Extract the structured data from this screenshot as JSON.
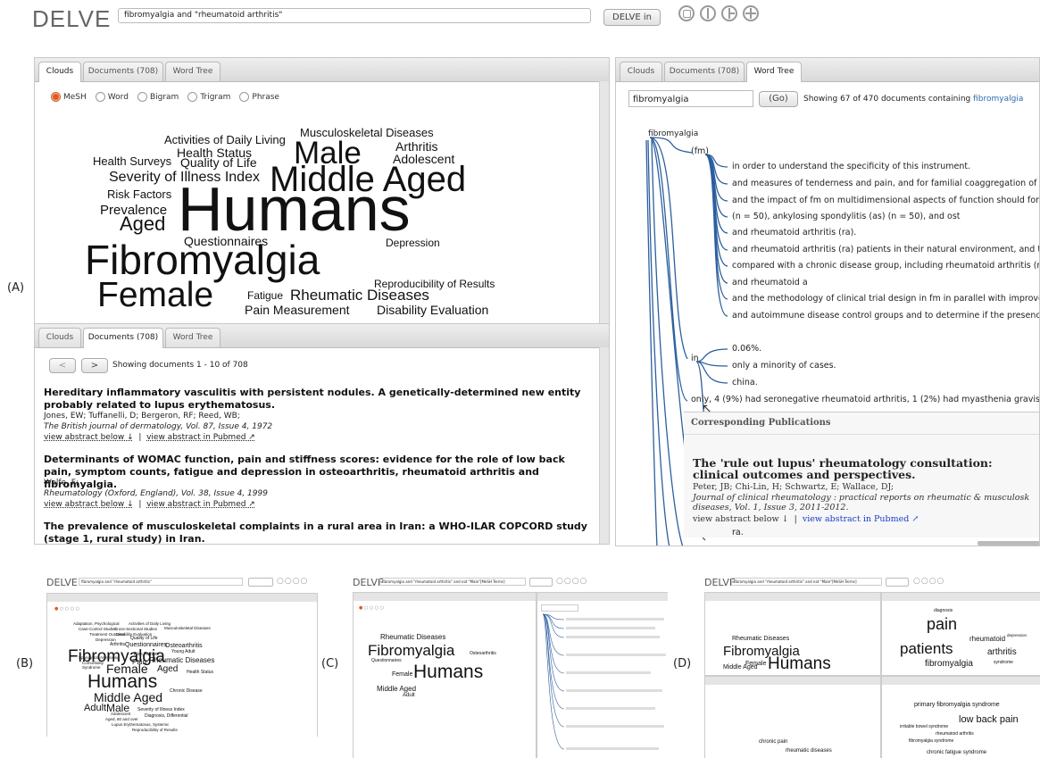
{
  "header": {
    "logo": "DELVE",
    "query": "fibromyalgia and \"rheumatoid arthritis\"",
    "delve_button": "DELVE in",
    "layout_icons": [
      "single-pane-icon",
      "two-pane-icon",
      "three-pane-icon",
      "four-pane-icon"
    ]
  },
  "labels": {
    "a": "(A)",
    "b": "(B)",
    "c": "(C)",
    "d": "(D)"
  },
  "panel_clouds": {
    "tabs": [
      "Clouds",
      "Documents (708)",
      "Word Tree"
    ],
    "radios": [
      "MeSH",
      "Word",
      "Bigram",
      "Trigram",
      "Phrase"
    ],
    "words": [
      "Musculoskeletal Diseases",
      "Activities of Daily Living",
      "Male",
      "Arthritis",
      "Health Status",
      "Adolescent",
      "Health Surveys",
      "Quality of Life",
      "Severity of Illness Index",
      "Middle Aged",
      "Risk Factors",
      "Prevalence",
      "Humans",
      "Aged",
      "Questionnaires",
      "Depression",
      "Fibromyalgia",
      "Reproducibility of Results",
      "Female",
      "Fatigue",
      "Rheumatic Diseases",
      "Pain Measurement",
      "Disability Evaluation"
    ]
  },
  "panel_docs": {
    "tabs": [
      "Clouds",
      "Documents (708)",
      "Word Tree"
    ],
    "prev": "<",
    "next": ">",
    "showing": "Showing documents 1 - 10 of 708",
    "docs": [
      {
        "title": "Hereditary inflammatory vasculitis with persistent nodules. A genetically-determined new entity probably related to lupus erythematosus.",
        "authors": "Jones, EW; Tuffanelli, D; Bergeron, RF; Reed, WB;",
        "journal": "The British journal of dermatology, Vol. 87, Issue 4, 1972",
        "abstract_link": "view abstract below ↓",
        "pubmed_link": "view abstract in Pubmed ↗"
      },
      {
        "title": "Determinants of WOMAC function, pain and stiffness scores: evidence for the role of low back pain, symptom counts, fatigue and depression in osteoarthritis, rheumatoid arthritis and fibromyalgia.",
        "authors": "Wolfe, F;",
        "journal": "Rheumatology (Oxford, England), Vol. 38, Issue 4, 1999",
        "abstract_link": "view abstract below ↓",
        "pubmed_link": "view abstract in Pubmed ↗"
      },
      {
        "title": "The prevalence of musculoskeletal complaints in a rural area in Iran: a WHO-ILAR COPCORD study (stage 1, rural study) in Iran."
      }
    ]
  },
  "panel_tree": {
    "tabs": [
      "Clouds",
      "Documents (708)",
      "Word Tree"
    ],
    "input": "fibromyalgia",
    "go": "(Go)",
    "showing_prefix": "Showing 67 of 470 documents containing ",
    "showing_term": "fibromyalgia",
    "root": "fibromyalgia",
    "node_fm": "(fm)",
    "node_in": "in",
    "fm_branches": [
      "in order to understand the specificity of this instrument.",
      "and measures of tenderness and pain, and for familial coaggregation of fi",
      "and the impact of fm on multidimensional aspects of function should forr",
      "(n = 50), ankylosing spondylitis (as) (n = 50), and ost",
      "and rheumatoid arthritis (ra).",
      "and rheumatoid arthritis (ra) patients in their natural environment, and t",
      "compared with a chronic disease group, including rheumatoid arthritis (r",
      "and rheumatoid a",
      "and the methodology of clinical trial design in fm in parallel with improve",
      "and autoimmune disease control groups and to determine if the presenc"
    ],
    "in_branches": [
      "0.06%.",
      "only a minority of cases.",
      "china."
    ],
    "only_line": "only, 4 (9%) had seronegative rheumatoid arthritis, 1 (2%) had myasthenia gravis,",
    "pub_header": "Corresponding Publications",
    "pub_title": "The 'rule out lupus' rheumatology consultation: clinical outcomes and perspectives.",
    "pub_authors": "Peter, JB; Chi-Lin, H; Schwartz, E; Wallace, DJ;",
    "pub_journal": "Journal of clinical rheumatology : practical reports on rheumatic & musculosk diseases, Vol. 1, Issue 3, 2011-2012.",
    "pub_abstract": "view abstract below ↓",
    "pub_pubmed": "view abstract in Pubmed ↗",
    "ra": "ra."
  },
  "thumbs": {
    "b_query": "fibromyalgia and \"rheumatoid arthritis\"",
    "b_words": [
      "Adaptation, Psychological",
      "Activities of Daily Living",
      "Musculoskeletal Diseases",
      "Case-Control Studies",
      "Cross-Sectional Studies",
      "Disability Evaluation",
      "Treatment Outcome",
      "Quality of Life",
      "Depression",
      "Arthritis",
      "Questionnaires",
      "Osteoarthritis",
      "Young Adult",
      "Spondylitis, Ankylosing",
      "Risk Factors",
      "Fibromyalgia",
      "Pain",
      "Rheumatic Diseases",
      "Comorbidity",
      "Syndrome",
      "Female",
      "Aged",
      "Health Status",
      "Humans",
      "Middle Aged",
      "Chronic Disease",
      "Male",
      "Adult",
      "Adolescent",
      "Severity of Illness Index",
      "Aged, 80 and over",
      "Diagnosis, Differential",
      "Lupus Erythematosus, Systemic",
      "Reproducibility of Results"
    ],
    "c_query": "fibromyalgia and \"rheumatoid arthritis\" and not \"Male\"[MeSH Terms]",
    "c_words": [
      "Fibromyalgia",
      "Humans",
      "Female",
      "Middle Aged",
      "Adult",
      "Rheumatic Diseases",
      "Osteoarthritis",
      "Questionnaires"
    ],
    "d_query": "fibromyalgia and \"rheumatoid arthritis\" and not \"Male\"[MeSH Terms]",
    "d_words": [
      "Fibromyalgia",
      "Humans",
      "Female",
      "Middle Aged",
      "Rheumatic Diseases"
    ],
    "d_words2": [
      "pain",
      "patients",
      "fibromyalgia",
      "arthritis",
      "rheumatoid",
      "diagnosis",
      "syndrome",
      "depression"
    ],
    "d_words3": [
      "chronic pain",
      "low back pain",
      "rheumatoid arthritis",
      "chronic fatigue syndrome",
      "irritable bowel syndrome",
      "rheumatic diseases",
      "primary fibromyalgia syndrome",
      "fibromyalgia syndrome"
    ]
  }
}
